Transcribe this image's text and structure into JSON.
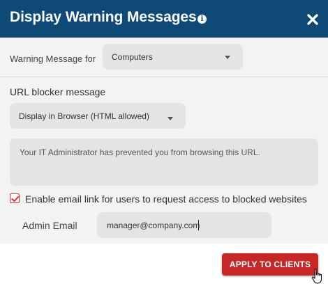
{
  "dialog": {
    "title": "Display Warning Messages",
    "info_icon": "info-icon",
    "close_icon": "close-icon"
  },
  "warning_target": {
    "label": "Warning Message for",
    "selected": "Computers"
  },
  "url_blocker": {
    "section_title": "URL blocker message",
    "display_mode_selected": "Display in Browser (HTML allowed)",
    "message": "Your IT Administrator has prevented you from browsing this URL."
  },
  "email_link": {
    "checked": true,
    "label": "Enable email link for users to request access to blocked websites",
    "admin_label": "Admin Email",
    "admin_value": "manager@company.com"
  },
  "footer": {
    "apply_label": "APPLY TO CLIENTS"
  },
  "colors": {
    "header_bg": "#0e4a75",
    "body_bg": "#f3f3f3",
    "field_bg": "#e4e4e4",
    "accent_red": "#c62828"
  }
}
